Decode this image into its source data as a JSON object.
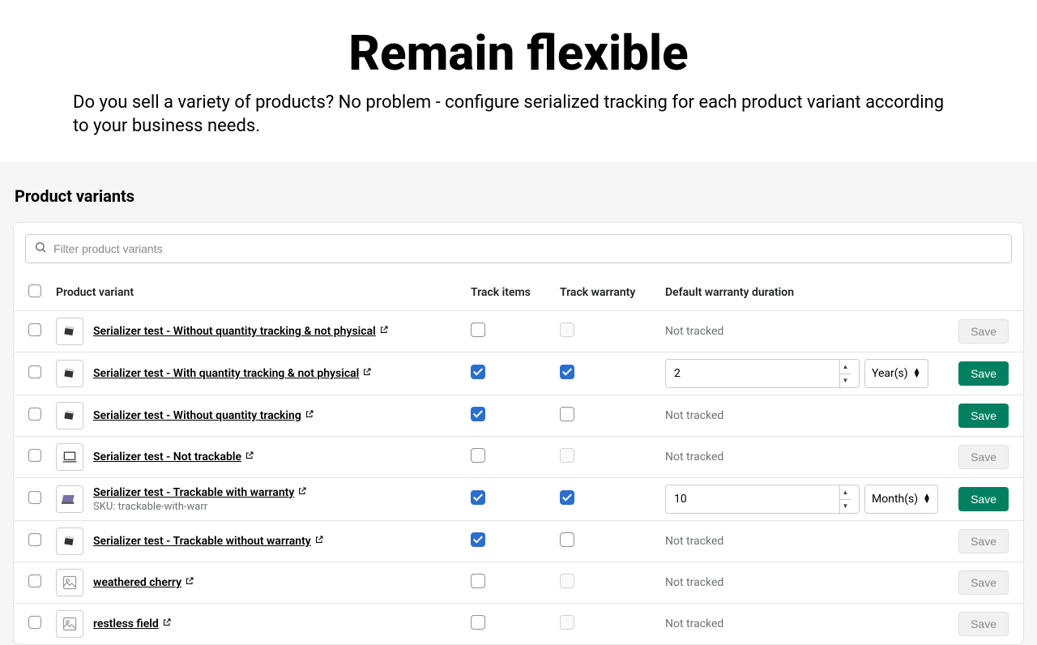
{
  "hero": {
    "title": "Remain flexible",
    "subtitle": "Do you sell a variety of products? No problem - configure serialized tracking for each product variant according to your business needs."
  },
  "section_title": "Product variants",
  "search": {
    "placeholder": "Filter product variants"
  },
  "headers": {
    "variant": "Product variant",
    "track_items": "Track items",
    "track_warranty": "Track warranty",
    "duration": "Default warranty duration"
  },
  "labels": {
    "save": "Save",
    "not_tracked": "Not tracked"
  },
  "units": {
    "year": "Year(s)",
    "month": "Month(s)"
  },
  "rows": [
    {
      "name": "Serializer test - Without quantity tracking & not physical",
      "sku": "",
      "thumb": "device",
      "track_items": false,
      "track_items_enabled": true,
      "track_warranty": false,
      "track_warranty_enabled": false,
      "duration": null,
      "unit": null,
      "save_active": false
    },
    {
      "name": "Serializer test - With quantity tracking & not physical",
      "sku": "",
      "thumb": "device",
      "track_items": true,
      "track_items_enabled": true,
      "track_warranty": true,
      "track_warranty_enabled": true,
      "duration": "2",
      "unit": "year",
      "save_active": true
    },
    {
      "name": "Serializer test - Without quantity tracking",
      "sku": "",
      "thumb": "device",
      "track_items": true,
      "track_items_enabled": true,
      "track_warranty": false,
      "track_warranty_enabled": true,
      "duration": null,
      "unit": null,
      "save_active": true
    },
    {
      "name": "Serializer test - Not trackable",
      "sku": "",
      "thumb": "laptop-line",
      "track_items": false,
      "track_items_enabled": true,
      "track_warranty": false,
      "track_warranty_enabled": false,
      "duration": null,
      "unit": null,
      "save_active": false
    },
    {
      "name": "Serializer test - Trackable with warranty",
      "sku": "SKU: trackable-with-warr",
      "thumb": "laptop-purple",
      "track_items": true,
      "track_items_enabled": true,
      "track_warranty": true,
      "track_warranty_enabled": true,
      "duration": "10",
      "unit": "month",
      "save_active": true
    },
    {
      "name": "Serializer test - Trackable without warranty",
      "sku": "",
      "thumb": "device",
      "track_items": true,
      "track_items_enabled": true,
      "track_warranty": false,
      "track_warranty_enabled": true,
      "duration": null,
      "unit": null,
      "save_active": false
    },
    {
      "name": "weathered cherry",
      "sku": "",
      "thumb": "placeholder",
      "track_items": false,
      "track_items_enabled": true,
      "track_warranty": false,
      "track_warranty_enabled": false,
      "duration": null,
      "unit": null,
      "save_active": false
    },
    {
      "name": "restless field",
      "sku": "",
      "thumb": "placeholder",
      "track_items": false,
      "track_items_enabled": true,
      "track_warranty": false,
      "track_warranty_enabled": false,
      "duration": null,
      "unit": null,
      "save_active": false
    }
  ]
}
